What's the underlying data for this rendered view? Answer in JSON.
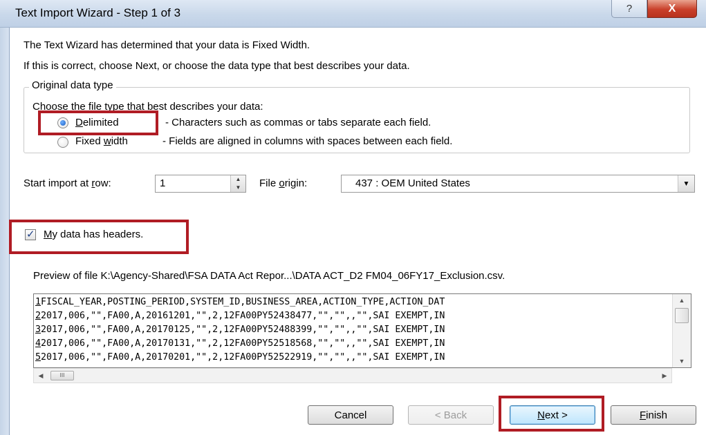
{
  "window": {
    "title": "Text Import Wizard - Step 1 of 3",
    "help_label": "?",
    "close_label": "X"
  },
  "intro": {
    "line1": "The Text Wizard has determined that your data is Fixed Width.",
    "line2": "If this is correct, choose Next, or choose the data type that best describes your data."
  },
  "original_data_type": {
    "legend": "Original data type",
    "prompt": "Choose the file type that best describes your data:",
    "options": [
      {
        "key": "D",
        "rest": "elimited",
        "description": "- Characters such as commas or tabs separate each field.",
        "selected": true
      },
      {
        "prefix": "Fixed ",
        "key": "w",
        "rest": "idth",
        "description": "- Fields are aligned in columns with spaces between each field.",
        "selected": false
      }
    ]
  },
  "start_row": {
    "label_pre": "Start import at ",
    "label_key": "r",
    "label_post": "ow:",
    "value": "1"
  },
  "file_origin": {
    "label_pre": "File ",
    "label_key": "o",
    "label_post": "rigin:",
    "value": "437 : OEM United States"
  },
  "headers": {
    "label_key": "M",
    "label_rest": "y data has headers.",
    "checked": true
  },
  "preview": {
    "caption": "Preview of file K:\\Agency-Shared\\FSA DATA Act Repor...\\DATA ACT_D2 FM04_06FY17_Exclusion.csv.",
    "rows": [
      {
        "n": "1",
        "text": "FISCAL_YEAR,POSTING_PERIOD,SYSTEM_ID,BUSINESS_AREA,ACTION_TYPE,ACTION_DAT"
      },
      {
        "n": "2",
        "text": "2017,006,\"\",FA00,A,20161201,\"\",2,12FA00PY52438477,\"\",\"\",,\"\",SAI EXEMPT,IN"
      },
      {
        "n": "3",
        "text": "2017,006,\"\",FA00,A,20170125,\"\",2,12FA00PY52488399,\"\",\"\",,\"\",SAI EXEMPT,IN"
      },
      {
        "n": "4",
        "text": "2017,006,\"\",FA00,A,20170131,\"\",2,12FA00PY52518568,\"\",\"\",,\"\",SAI EXEMPT,IN"
      },
      {
        "n": "5",
        "text": "2017,006,\"\",FA00,A,20170201,\"\",2,12FA00PY52522919,\"\",\"\",,\"\",SAI EXEMPT,IN"
      }
    ],
    "hscroll_thumb": "III"
  },
  "buttons": {
    "cancel": "Cancel",
    "back": "< Back",
    "next_key": "N",
    "next_rest": "ext >",
    "finish_key": "F",
    "finish_rest": "inish"
  },
  "colors": {
    "highlight_box": "#b01c24",
    "title_bar": "#c9d8ea"
  }
}
